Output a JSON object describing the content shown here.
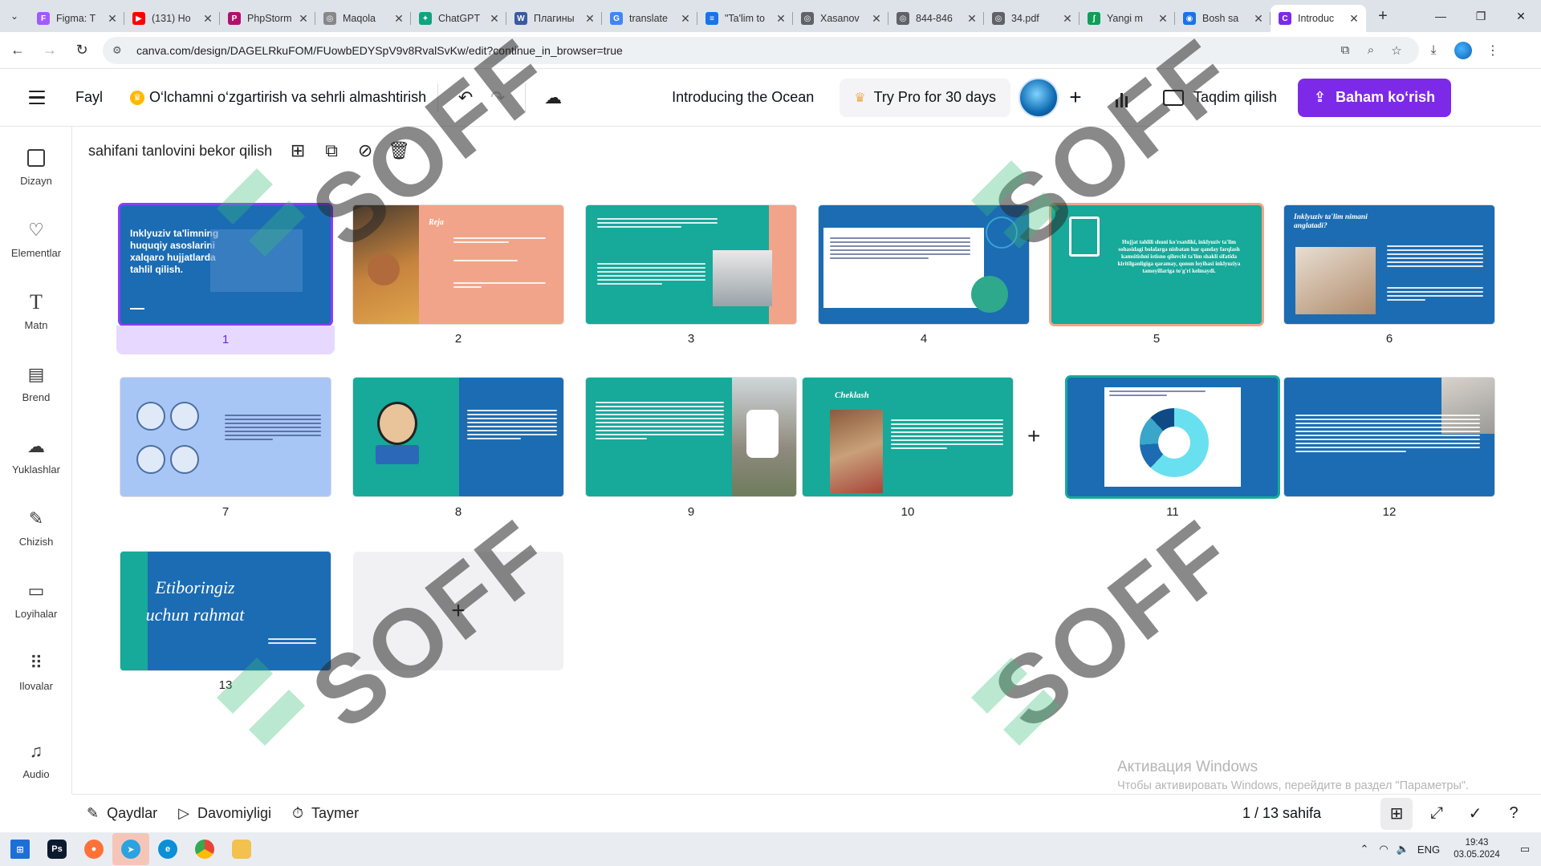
{
  "browser": {
    "tabs": [
      {
        "title": "Figma: T",
        "fav_color": "#a259ff",
        "fav": "F"
      },
      {
        "title": "(131) Ho",
        "fav_color": "#ff0000",
        "fav": "▶"
      },
      {
        "title": "PhpStorm",
        "fav_color": "#b0116a",
        "fav": "P"
      },
      {
        "title": "Maqola",
        "fav_color": "#888888",
        "fav": "◎"
      },
      {
        "title": "ChatGPT",
        "fav_color": "#10a37f",
        "fav": "✦"
      },
      {
        "title": "Плагины",
        "fav_color": "#3a5ba0",
        "fav": "W"
      },
      {
        "title": "translate",
        "fav_color": "#4285f4",
        "fav": "G"
      },
      {
        "title": "\"Ta'lim to",
        "fav_color": "#1a73e8",
        "fav": "≡"
      },
      {
        "title": "Xasanov",
        "fav_color": "#5f6368",
        "fav": "◎"
      },
      {
        "title": "844-846",
        "fav_color": "#5f6368",
        "fav": "◎"
      },
      {
        "title": "34.pdf",
        "fav_color": "#5f6368",
        "fav": "◎"
      },
      {
        "title": "Yangi m",
        "fav_color": "#0f9d58",
        "fav": "ʃ"
      },
      {
        "title": "Bosh sa",
        "fav_color": "#1a73e8",
        "fav": "◉"
      },
      {
        "title": "Introduc",
        "fav_color": "#7d2ae8",
        "fav": "C",
        "active": true
      }
    ],
    "url": "canva.com/design/DAGELRkuFOM/FUowbEDYSpV9v8RvalSvKw/edit?continue_in_browser=true"
  },
  "canva": {
    "file_label": "Fayl",
    "resize_label": "O‘lchamni o‘zgartirish va sehrli almashtirish",
    "doc_title": "Introducing the Ocean",
    "try_pro_label": "Try Pro for 30 days",
    "present_label": "Taqdim qilish",
    "share_label": "Baham ko‘rish",
    "deselect_label": "sahifani tanlovini bekor qilish",
    "sidebar": [
      {
        "label": "Dizayn",
        "icon": "design-icon"
      },
      {
        "label": "Elementlar",
        "icon": "elements-icon"
      },
      {
        "label": "Matn",
        "icon": "text-icon"
      },
      {
        "label": "Brend",
        "icon": "brand-icon"
      },
      {
        "label": "Yuklashlar",
        "icon": "upload-icon"
      },
      {
        "label": "Chizish",
        "icon": "draw-icon"
      },
      {
        "label": "Loyihalar",
        "icon": "folder-icon"
      },
      {
        "label": "Ilovalar",
        "icon": "apps-icon"
      },
      {
        "label": "Audio",
        "icon": "audio-icon"
      }
    ],
    "slides": {
      "s1": {
        "num": "1",
        "title": "Inklyuziv ta'limning huquqiy asoslarini xalqaro hujjatlarda tahlil qilish."
      },
      "s2": {
        "num": "2",
        "title": "Reja"
      },
      "s3": {
        "num": "3"
      },
      "s4": {
        "num": "4"
      },
      "s5": {
        "num": "5",
        "text": "Hujjat tahlili shuni ko'rsatdiki, inklyuziv ta'lim sohasidagi bolalarga nisbatan har qanday farqlash kamsitishni istisno qiluvchi ta'lim shakli sifatida kiritilganligiga qaramay, qonun loyihasi inklyuziya tamoyillariga to'g'ri kelmaydi."
      },
      "s6": {
        "num": "6",
        "title": "Inklyuziv ta'lim nimani anglatadi?"
      },
      "s7": {
        "num": "7"
      },
      "s8": {
        "num": "8"
      },
      "s9": {
        "num": "9"
      },
      "s10": {
        "num": "10",
        "title": "Cheklash"
      },
      "s11": {
        "num": "11"
      },
      "s12": {
        "num": "12"
      },
      "s13": {
        "num": "13",
        "title": "Etiboringiz uchun rahmat"
      }
    },
    "bottom": {
      "notes_label": "Qaydlar",
      "duration_label": "Davomiyligi",
      "timer_label": "Taymer",
      "page_counter": "1 / 13 sahifa"
    }
  },
  "windows": {
    "activation_title": "Активация Windows",
    "activation_sub": "Чтобы активировать Windows, перейдите в раздел \"Параметры\".",
    "lang": "ENG",
    "time": "19:43",
    "date": "03.05.2024"
  },
  "watermark": "SOFF",
  "colors": {
    "canva_purple": "#7d2ae8",
    "slide_blue": "#1b6cb3",
    "slide_teal": "#17a999",
    "slide_salmon": "#f2a48a"
  }
}
